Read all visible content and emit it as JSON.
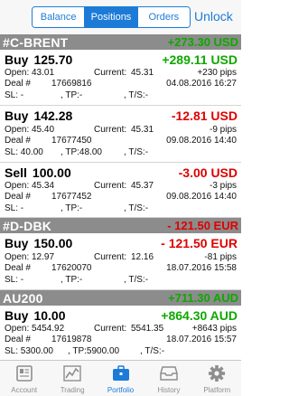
{
  "header": {
    "segments": [
      "Balance",
      "Positions",
      "Orders"
    ],
    "active_segment": "Positions",
    "unlock_label": "Unlock"
  },
  "groups": [
    {
      "symbol": "#C-BRENT",
      "total": "+273.30 USD",
      "positions": [
        {
          "side": "Buy",
          "volume": "125.70",
          "pnl": "+289.11 USD",
          "open_label": "Open:",
          "open": "43.01",
          "current_label": "Current:",
          "current": "45.31",
          "pips": "+230 pips",
          "deal_label": "Deal #",
          "deal": "17669816",
          "datetime": "04.08.2016 16:27",
          "sl": "SL: -",
          "tp": ", TP:-",
          "ts": ", T/S:-"
        },
        {
          "side": "Buy",
          "volume": "142.28",
          "pnl": "-12.81 USD",
          "open_label": "Open:",
          "open": "45.40",
          "current_label": "Current:",
          "current": "45.31",
          "pips": "-9 pips",
          "deal_label": "Deal #",
          "deal": "17677450",
          "datetime": "09.08.2016 14:40",
          "sl": "SL: 40.00",
          "tp": ", TP:48.00",
          "ts": ", T/S:-"
        },
        {
          "side": "Sell",
          "volume": "100.00",
          "pnl": "-3.00 USD",
          "open_label": "Open:",
          "open": "45.34",
          "current_label": "Current:",
          "current": "45.37",
          "pips": "-3 pips",
          "deal_label": "Deal #",
          "deal": "17677452",
          "datetime": "09.08.2016 14:40",
          "sl": "SL: -",
          "tp": ", TP:-",
          "ts": ", T/S:-"
        }
      ]
    },
    {
      "symbol": "#D-DBK",
      "total": "- 121.50 EUR",
      "positions": [
        {
          "side": "Buy",
          "volume": "150.00",
          "pnl": "- 121.50 EUR",
          "open_label": "Open:",
          "open": "12.97",
          "current_label": "Current:",
          "current": "12.16",
          "pips": "-81 pips",
          "deal_label": "Deal #",
          "deal": "17620070",
          "datetime": "18.07.2016 15:58",
          "sl": "SL: -",
          "tp": ", TP:-",
          "ts": ", T/S:-"
        }
      ]
    },
    {
      "symbol": "AU200",
      "total": "+711.30 AUD",
      "positions": [
        {
          "side": "Buy",
          "volume": "10.00",
          "pnl": "+864.30 AUD",
          "open_label": "Open:",
          "open": "5454.92",
          "current_label": "Current:",
          "current": "5541.35",
          "pips": "+8643 pips",
          "deal_label": "Deal #",
          "deal": "17619878",
          "datetime": "18.07.2016 15:57",
          "sl": "SL: 5300.00",
          "tp": ", TP:5900.00",
          "ts": ", T/S:-"
        }
      ]
    }
  ],
  "tabbar": {
    "items": [
      {
        "label": "Account",
        "icon": "account-icon"
      },
      {
        "label": "Trading",
        "icon": "trading-chart-icon"
      },
      {
        "label": "Portfolio",
        "icon": "briefcase-icon"
      },
      {
        "label": "History",
        "icon": "history-tray-icon"
      },
      {
        "label": "Platform",
        "icon": "gear-icon"
      }
    ],
    "active": "Portfolio"
  },
  "colors": {
    "accent": "#1d7bd8",
    "profit": "#0ea800",
    "loss": "#e00000",
    "group_header_bg": "#8c8c8c"
  }
}
